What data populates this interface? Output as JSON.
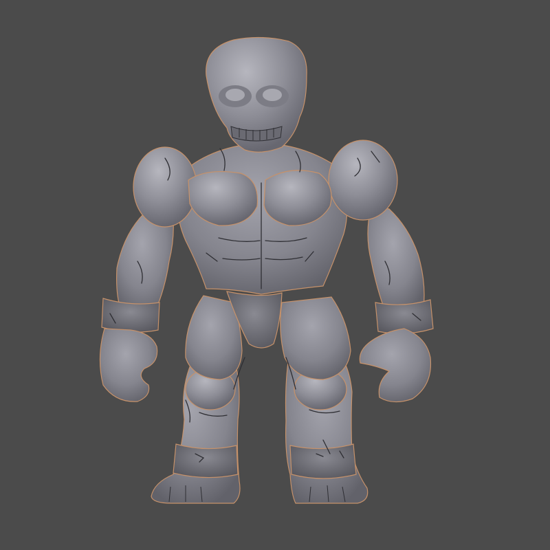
{
  "scene": {
    "background_color": "#4b4b4b",
    "subject": "sculpted-stone-golem-model",
    "material_color": "#8a8a93",
    "highlight_color": "#b9b9c2",
    "shadow_color": "#5e5e66",
    "crack_color": "#2e2e33",
    "outline_color": "#c7926a"
  }
}
